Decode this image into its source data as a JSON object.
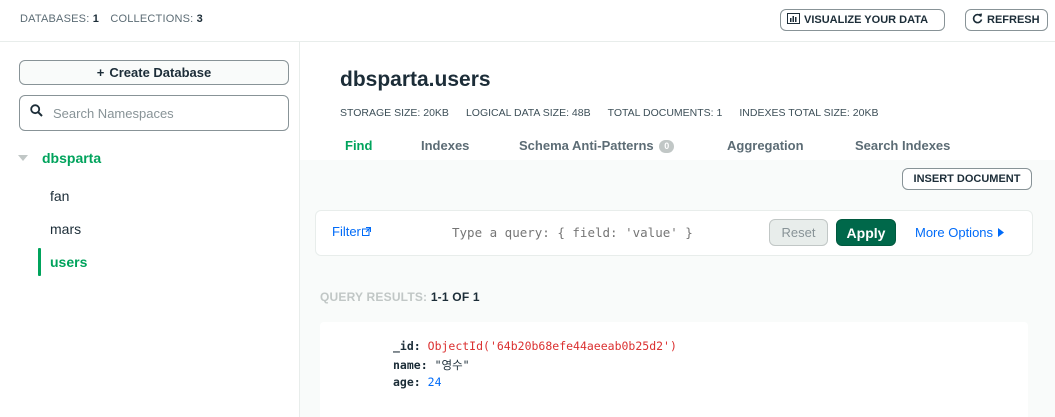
{
  "topbar": {
    "databases_label": "DATABASES:",
    "databases_count": "1",
    "collections_label": "COLLECTIONS:",
    "collections_count": "3",
    "visualize_label": "VISUALIZE YOUR DATA",
    "refresh_label": "REFRESH"
  },
  "sidebar": {
    "create_database_label": "Create Database",
    "search_placeholder": "Search Namespaces",
    "database": "dbsparta",
    "collections": [
      "fan",
      "mars",
      "users"
    ],
    "active_collection": "users"
  },
  "main": {
    "title": "dbsparta.users",
    "stats": [
      "STORAGE SIZE: 20KB",
      "LOGICAL DATA SIZE: 48B",
      "TOTAL DOCUMENTS: 1",
      "INDEXES TOTAL SIZE: 20KB"
    ],
    "tabs": [
      {
        "label": "Find",
        "active": true
      },
      {
        "label": "Indexes"
      },
      {
        "label": "Schema Anti-Patterns",
        "badge": "0"
      },
      {
        "label": "Aggregation"
      },
      {
        "label": "Search Indexes"
      }
    ],
    "insert_document_label": "INSERT DOCUMENT",
    "query": {
      "filter_label": "Filter",
      "placeholder": "Type a query: { field: 'value' }",
      "reset_label": "Reset",
      "apply_label": "Apply",
      "more_options_label": "More Options"
    },
    "results": {
      "label": "QUERY RESULTS:",
      "range": "1-1 OF 1"
    },
    "document": {
      "id_key": "_id:",
      "id_value": "ObjectId('64b20b68efe44aeeab0b25d2')",
      "name_key": "name:",
      "name_value": "\"영수\"",
      "age_key": "age:",
      "age_value": "24"
    }
  },
  "colors": {
    "accent_green": "#00a35c",
    "apply_green": "#00684a",
    "link_blue": "#016bf8",
    "objectid_red": "#db3030"
  }
}
